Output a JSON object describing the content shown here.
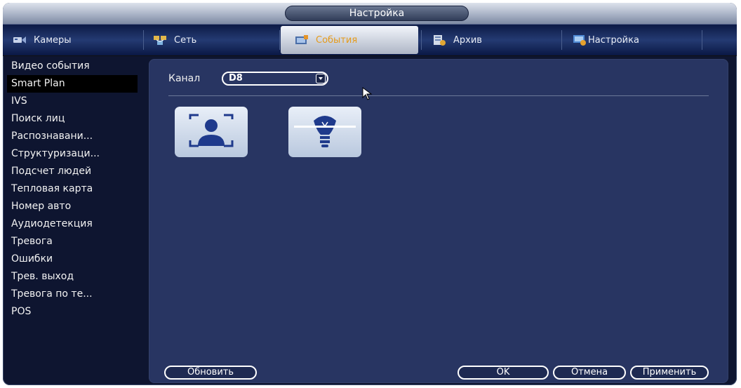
{
  "window": {
    "title": "Настройка"
  },
  "tabs": [
    {
      "label": "Камеры",
      "icon": "camera-icon",
      "active": false
    },
    {
      "label": "Сеть",
      "icon": "network-icon",
      "active": false
    },
    {
      "label": "События",
      "icon": "events-icon",
      "active": true
    },
    {
      "label": "Архив",
      "icon": "archive-icon",
      "active": false
    },
    {
      "label": "Настройка",
      "icon": "settings-icon",
      "active": false
    }
  ],
  "sidebar": {
    "selected": "Smart Plan",
    "items": [
      {
        "label": "Видео события"
      },
      {
        "label": "Smart Plan"
      },
      {
        "label": "IVS"
      },
      {
        "label": "Поиск лиц"
      },
      {
        "label": "Распознавани..."
      },
      {
        "label": "Структуризаци..."
      },
      {
        "label": "Подсчет людей"
      },
      {
        "label": "Тепловая карта"
      },
      {
        "label": "Номер авто"
      },
      {
        "label": "Аудиодетекция"
      },
      {
        "label": "Тревога"
      },
      {
        "label": "Ошибки"
      },
      {
        "label": "Трев. выход"
      },
      {
        "label": "Тревога по те..."
      },
      {
        "label": "POS"
      }
    ]
  },
  "main": {
    "channel_label": "Канал",
    "channel_value": "D8",
    "functions": [
      {
        "icon": "face-detection-icon"
      },
      {
        "icon": "tripwire-icon"
      }
    ]
  },
  "buttons": {
    "refresh": "Обновить",
    "ok": "OK",
    "cancel": "Отмена",
    "apply": "Применить"
  },
  "colors": {
    "active_tab_text": "#e59b1b",
    "panel_bg": "#283562",
    "selected_item_bg": "#000000"
  }
}
